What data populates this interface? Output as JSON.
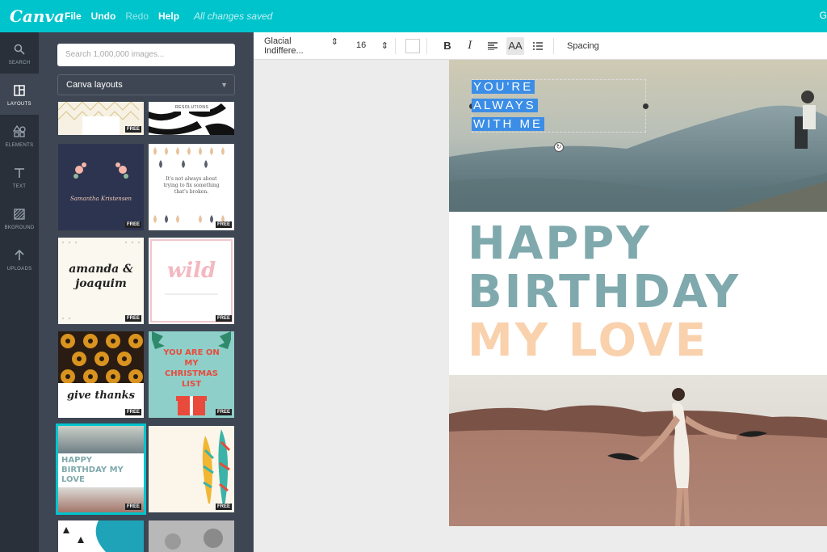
{
  "app": {
    "logo": "Canva",
    "menu": [
      "File",
      "Undo",
      "Redo",
      "Help"
    ],
    "status": "All changes saved",
    "share_fragment": "G"
  },
  "rail": [
    {
      "label": "SEARCH",
      "icon": "search-icon"
    },
    {
      "label": "LAYOUTS",
      "icon": "layouts-icon",
      "active": true
    },
    {
      "label": "ELEMENTS",
      "icon": "elements-icon"
    },
    {
      "label": "TEXT",
      "icon": "text-icon"
    },
    {
      "label": "BKGROUND",
      "icon": "background-icon"
    },
    {
      "label": "UPLOADS",
      "icon": "upload-icon"
    }
  ],
  "panel": {
    "search_placeholder": "Search 1,000,000 images...",
    "layout_select": "Canva layouts",
    "free_badge": "FREE",
    "thumbs": [
      {
        "kind": "pattern",
        "text": ""
      },
      {
        "kind": "zebra",
        "text": "RESOLUTIONS"
      },
      {
        "kind": "wreath",
        "text": "Samantha Kristensen"
      },
      {
        "kind": "drops",
        "text": "It's not always about trying to fix something that's broken."
      },
      {
        "kind": "names",
        "text": "amanda & joaquim"
      },
      {
        "kind": "wild",
        "text": "wild"
      },
      {
        "kind": "thanks",
        "text": "give thanks"
      },
      {
        "kind": "christmas",
        "text": "YOU ARE ON MY CHRISTMAS LIST"
      },
      {
        "kind": "birthday",
        "text": "HAPPY BIRTHDAY MY LOVE"
      },
      {
        "kind": "feathers",
        "text": ""
      },
      {
        "kind": "blue",
        "text": ""
      },
      {
        "kind": "photo",
        "text": ""
      }
    ]
  },
  "toolbar": {
    "font": "Glacial Indiffere...",
    "size": "16",
    "bold": "B",
    "italic": "I",
    "case": "AA",
    "spacing": "Spacing"
  },
  "design": {
    "quote": [
      "YOU'RE",
      "ALWAYS",
      "WITH ME"
    ],
    "headline": [
      "HAPPY",
      "BIRTHDAY",
      "MY LOVE"
    ]
  },
  "colors": {
    "brand": "#00c4cc",
    "rail": "#293039",
    "panel": "#3d4652",
    "headline_teal": "#7fa9ad",
    "headline_peach": "#f9d1ad",
    "selection": "#3b8de6"
  }
}
